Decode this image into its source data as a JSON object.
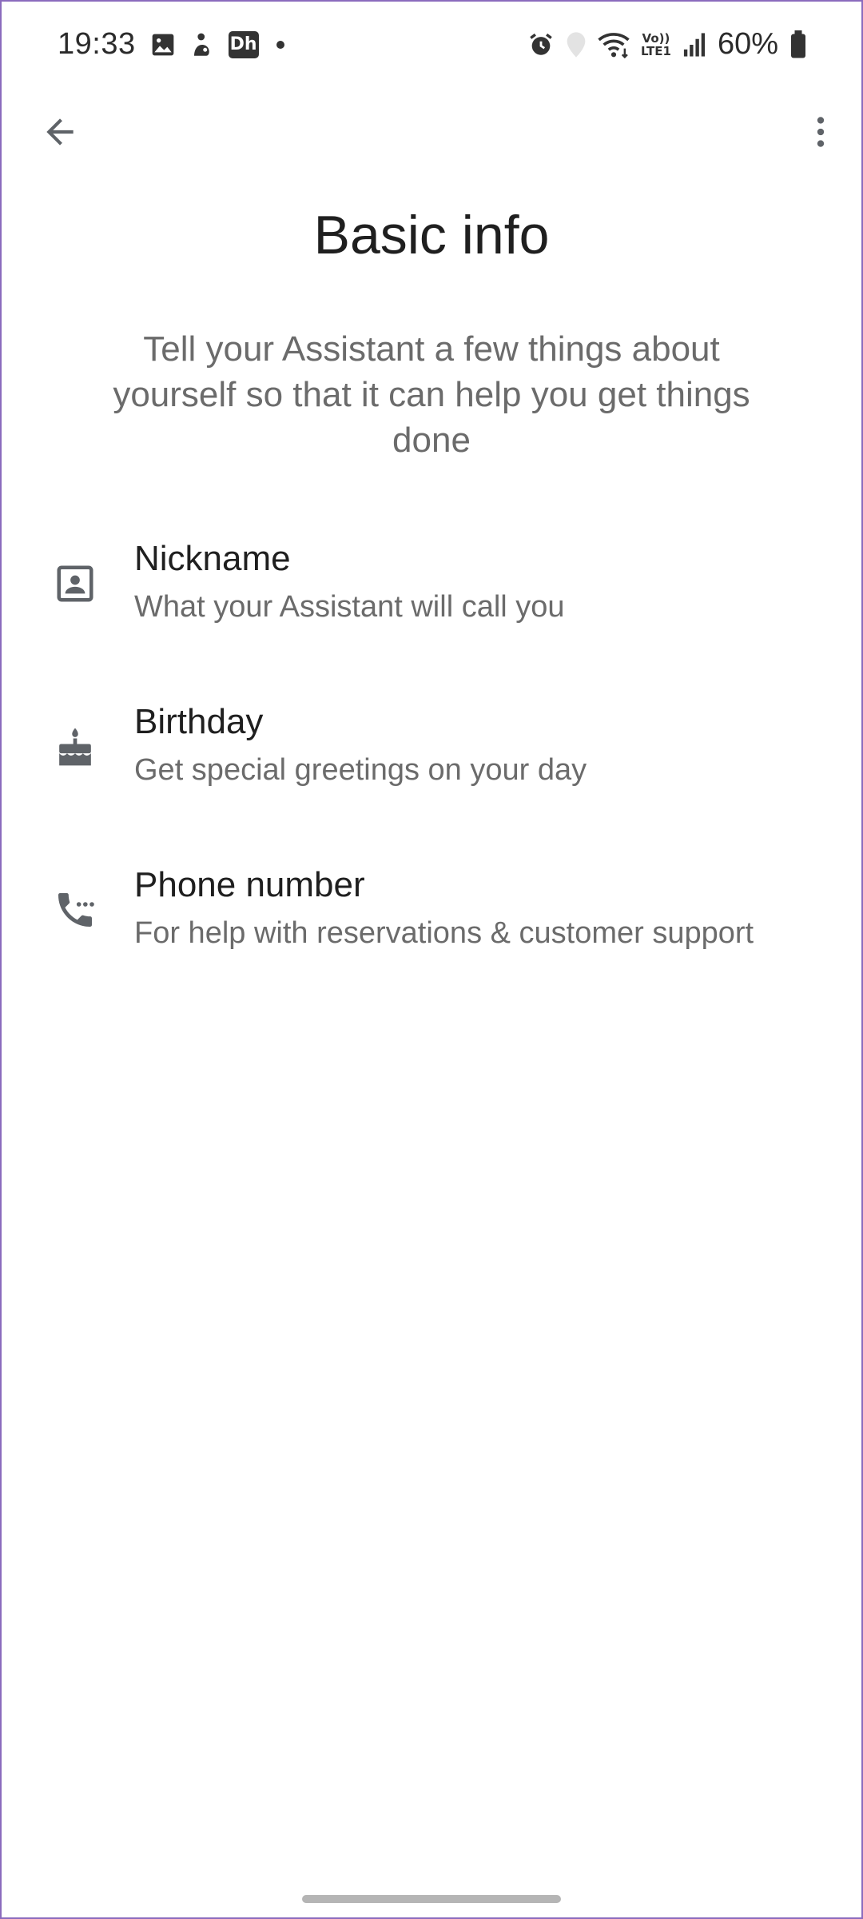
{
  "status_bar": {
    "time": "19:33",
    "battery": "60%",
    "icons_left": [
      "image-icon",
      "app-notification-icon",
      "dh-app-icon",
      "more-dot-icon"
    ],
    "dh_label": "Dh",
    "volte_top": "Vo))",
    "volte_bottom": "LTE1",
    "icons_right": [
      "alarm-icon",
      "location-icon",
      "wifi-icon",
      "volte-icon",
      "signal-icon",
      "battery-icon"
    ]
  },
  "app_bar": {
    "back_icon": "arrow-back-icon",
    "more_icon": "more-vert-icon"
  },
  "page": {
    "title": "Basic info",
    "description": "Tell your Assistant a few things about yourself so that it can help you get things done"
  },
  "items": [
    {
      "icon": "contact-card-icon",
      "title": "Nickname",
      "subtitle": "What your Assistant will call you"
    },
    {
      "icon": "cake-icon",
      "title": "Birthday",
      "subtitle": "Get special greetings on your day"
    },
    {
      "icon": "phone-dialing-icon",
      "title": "Phone number",
      "subtitle": "For help with reservations & customer support"
    }
  ],
  "colors": {
    "icon_gray": "#5f6368",
    "text_primary": "#1f1f1f",
    "text_secondary": "#6b6b6b",
    "nav_handle": "#b5b5b5"
  }
}
